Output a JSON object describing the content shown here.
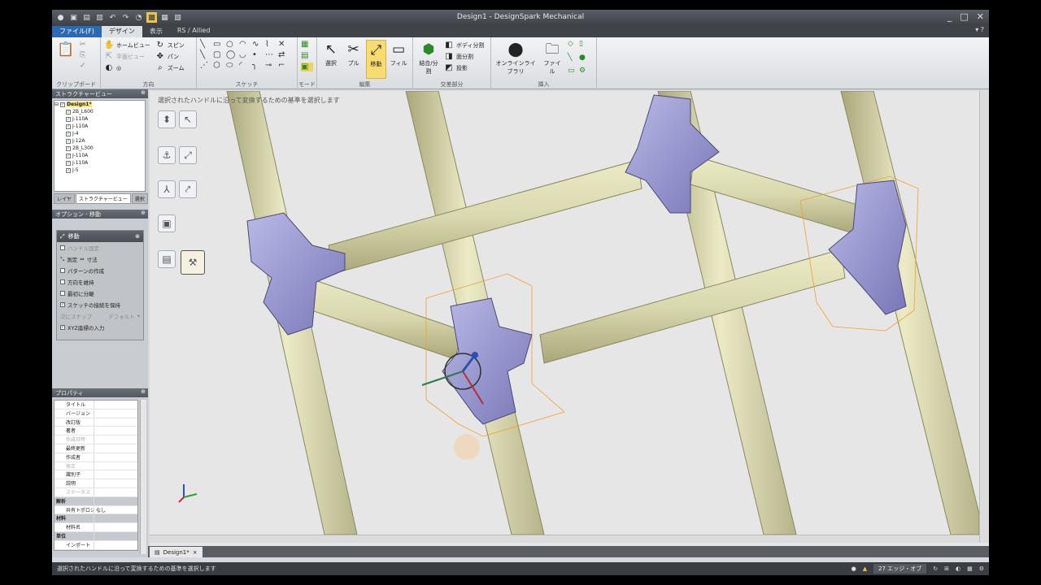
{
  "app": {
    "title": "Design1 - DesignSpark Mechanical",
    "window_controls": [
      "_",
      "□",
      "✕"
    ]
  },
  "quick_access": [
    "▣",
    "▤",
    "▥",
    "↶",
    "↷",
    "◔",
    "▩",
    "▦",
    "▧"
  ],
  "menu_tabs": [
    {
      "label": "ファイル(F)"
    },
    {
      "label": "デザイン"
    },
    {
      "label": "表示"
    },
    {
      "label": "RS / Allied"
    }
  ],
  "ribbon": {
    "groups": [
      {
        "label": "クリップボード"
      },
      {
        "label": "方向"
      },
      {
        "label": "スケッチ"
      },
      {
        "label": "モード"
      },
      {
        "label": "編集"
      },
      {
        "label": "交差部分"
      },
      {
        "label": "挿入"
      }
    ],
    "orient": [
      {
        "icon": "✋",
        "label": "ホームビュー"
      },
      {
        "icon": "⇱",
        "label": "平面ビュー"
      },
      {
        "icon": "◐",
        "label": "回転"
      },
      {
        "icon": "↻",
        "label": "スピン"
      },
      {
        "icon": "✥",
        "label": "パン"
      },
      {
        "icon": "⌕",
        "label": "ズーム"
      }
    ],
    "edit_buttons": [
      {
        "icon": "↖",
        "label": "選択"
      },
      {
        "icon": "✂",
        "label": "プル"
      },
      {
        "icon": "⤢",
        "label": "移動"
      },
      {
        "icon": "▭",
        "label": "フィル"
      }
    ],
    "intersect": {
      "combine": "結合/分割",
      "items": [
        "ボディ分割",
        "面分割",
        "投影"
      ]
    },
    "insert": {
      "online": "オンラインライブラリ",
      "file": "ファイル"
    }
  },
  "structure_panel": {
    "title": "ストラクチャービュー",
    "root": "Design1*",
    "items": [
      "2B_L600",
      "J-110A",
      "J-110A",
      "J-4",
      "J-12A",
      "2B_L300",
      "J-110A",
      "J-110A",
      "J-5"
    ],
    "tabs": [
      "レイヤ",
      "ストラクチャービュー",
      "選択"
    ]
  },
  "options_panel": {
    "title": "オプション - 移動",
    "tool": "移動",
    "rows": [
      {
        "label": "ハンドル固定",
        "checked": false,
        "disabled": true
      },
      {
        "label": "測定",
        "checked": false,
        "disabled": false,
        "extra": "寸法"
      },
      {
        "label": "パターンの作成",
        "checked": false,
        "disabled": false
      },
      {
        "label": "方向を維持",
        "checked": false,
        "disabled": false
      },
      {
        "label": "最初に分離",
        "checked": false,
        "disabled": false
      },
      {
        "label": "スケッチの接続を保持",
        "checked": true,
        "disabled": false
      },
      {
        "label": "次にスナップ",
        "checked": false,
        "disabled": true,
        "extra": "デフォルト"
      },
      {
        "label": "XYZ座標の入力",
        "checked": true,
        "disabled": false
      }
    ]
  },
  "properties_panel": {
    "title": "プロパティ",
    "rows": [
      {
        "k": "タイトル",
        "v": "",
        "cat": false,
        "dis": false
      },
      {
        "k": "バージョン",
        "v": "",
        "cat": false,
        "dis": false
      },
      {
        "k": "改訂版",
        "v": "",
        "cat": false,
        "dis": false
      },
      {
        "k": "著者",
        "v": "",
        "cat": false,
        "dis": false
      },
      {
        "k": "作成日時",
        "v": "",
        "cat": false,
        "dis": true
      },
      {
        "k": "最終更新",
        "v": "",
        "cat": false,
        "dis": false
      },
      {
        "k": "作成者",
        "v": "",
        "cat": false,
        "dis": false
      },
      {
        "k": "修正",
        "v": "",
        "cat": false,
        "dis": true
      },
      {
        "k": "識別子",
        "v": "",
        "cat": false,
        "dis": false
      },
      {
        "k": "説明",
        "v": "",
        "cat": false,
        "dis": false
      },
      {
        "k": "ステータス",
        "v": "",
        "cat": false,
        "dis": true
      },
      {
        "k": "解析",
        "v": "",
        "cat": true,
        "dis": false
      },
      {
        "k": "共有トポロジー",
        "v": "なし",
        "cat": false,
        "dis": false
      },
      {
        "k": "材料",
        "v": "",
        "cat": true,
        "dis": false
      },
      {
        "k": "材料名",
        "v": "",
        "cat": false,
        "dis": false
      },
      {
        "k": "単位",
        "v": "",
        "cat": true,
        "dis": false
      },
      {
        "k": "インポート",
        "v": "",
        "cat": false,
        "dis": false
      }
    ]
  },
  "viewport": {
    "prompt": "選択されたハンドルに沿って変換するための基準を選択します"
  },
  "doc_tab": {
    "label": "Design1*",
    "close": "×"
  },
  "status": {
    "message": "選択されたハンドルに沿って変換するための基準を選択します",
    "selection": "27 エッジ・オブ"
  }
}
